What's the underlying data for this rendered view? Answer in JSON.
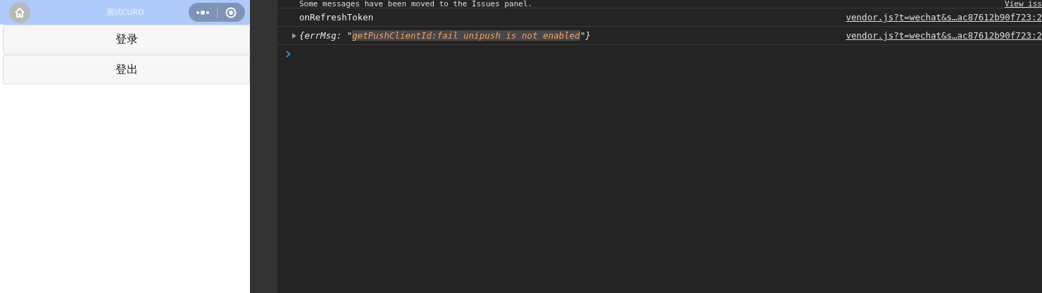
{
  "mini_program": {
    "title": "测试CURD",
    "buttons": [
      "登录",
      "登出"
    ]
  },
  "console": {
    "messages": [
      {
        "kind": "info",
        "text": "Some messages have been moved to the Issues panel.",
        "source": "View iss"
      },
      {
        "kind": "log",
        "text": "onRefreshToken",
        "source": "vendor.js?t=wechat&s…ac87612b90f723:2"
      },
      {
        "kind": "object",
        "expanded": false,
        "open": "{errMsg: \"",
        "value": "getPushClientId:fail unipush is not enabled",
        "close": "\"}",
        "source": "vendor.js?t=wechat&s…ac87612b90f723:2"
      }
    ]
  }
}
